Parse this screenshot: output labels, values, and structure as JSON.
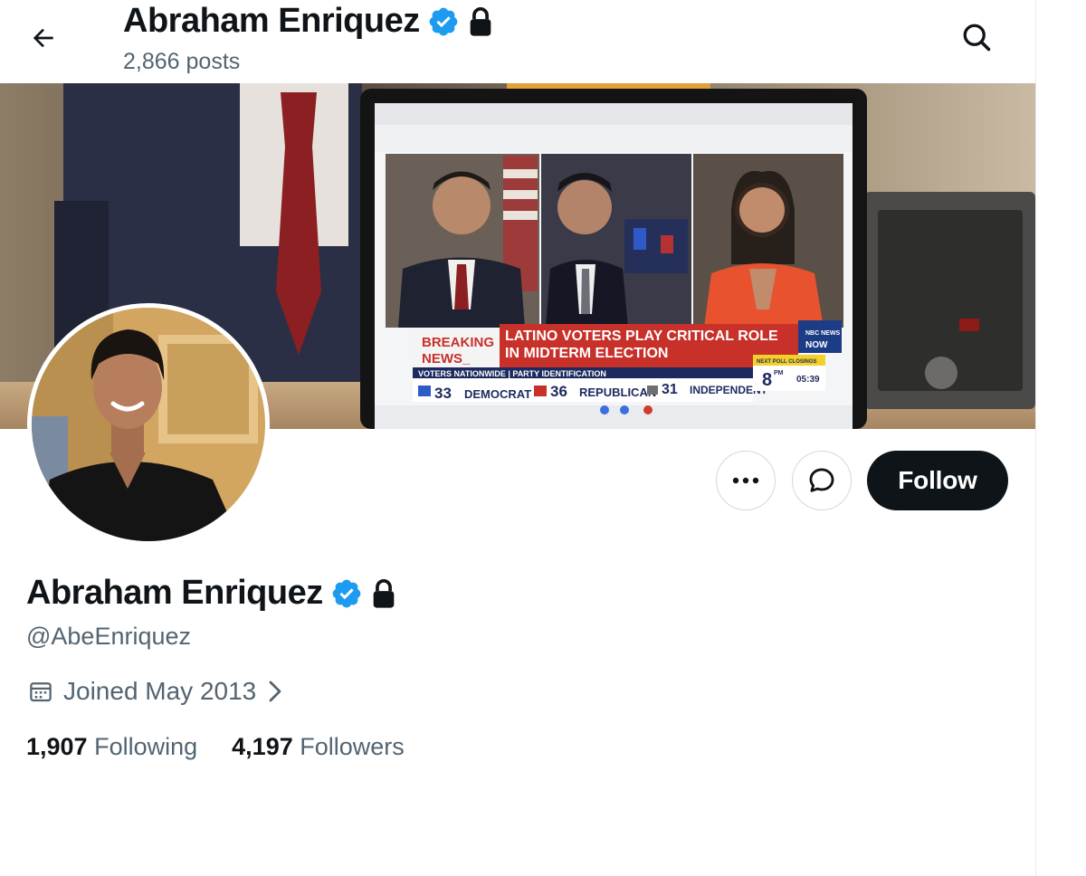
{
  "header": {
    "name": "Abraham Enriquez",
    "posts": "2,866 posts"
  },
  "banner": {
    "breaking": [
      "BREAKING",
      "NEWS_"
    ],
    "headline": [
      "LATINO VOTERS PLAY CRITICAL ROLE",
      "IN MIDTERM ELECTION"
    ],
    "subbar": "VOTERS NATIONWIDE | PARTY IDENTIFICATION",
    "poll": [
      {
        "pct": "33",
        "label": "DEMOCRAT"
      },
      {
        "pct": "36",
        "label": "REPUBLICAN"
      },
      {
        "pct": "31",
        "label": "INDEPENDENT"
      }
    ],
    "next_poll": "NEXT POLL CLOSINGS",
    "next_time": "8",
    "next_time_sup": "PM",
    "clock": "05:39",
    "network_top": "NBC NEWS",
    "network_bottom": "NOW"
  },
  "profile": {
    "name": "Abraham Enriquez",
    "handle": "@AbeEnriquez",
    "joined": "Joined May 2013",
    "following_count": "1,907",
    "following_label": "Following",
    "followers_count": "4,197",
    "followers_label": "Followers"
  },
  "actions": {
    "follow_label": "Follow",
    "more_label": "•••"
  },
  "colors": {
    "verified": "#1d9bf0",
    "text": "#0f1419",
    "secondary": "#536471",
    "news_red": "#c8302a"
  }
}
